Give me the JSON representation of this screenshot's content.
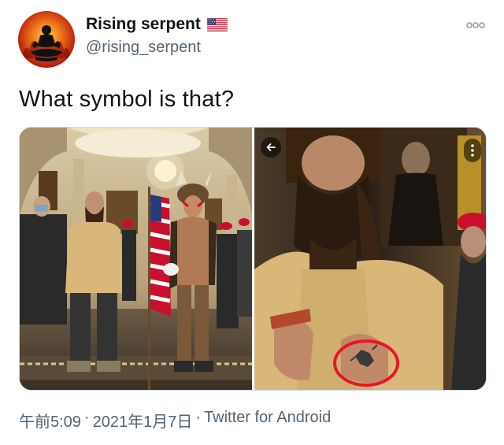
{
  "tweet": {
    "author": {
      "display_name": "Rising serpent",
      "handle": "@rising_serpent",
      "avatar_icon": "meditating-figure-avatar",
      "badge_icon": "us-flag-icon"
    },
    "text": "What symbol is that?",
    "more_icon": "more-options-icon",
    "media": {
      "count": 2,
      "left_photo": "group-of-people-in-capitol-hall",
      "right_photo": "zoomed-man-with-circled-tattoo",
      "back_icon": "back-arrow-icon",
      "menu_icon": "vertical-dots-icon",
      "highlight_color": "#e8152b"
    },
    "meta": {
      "time": "午前5:09",
      "separator1": "·",
      "date": "2021年1月7日",
      "separator2": "·",
      "source": "Twitter for Android"
    }
  },
  "colors": {
    "primary_text": "#0f1419",
    "secondary_text": "#536471",
    "background": "#ffffff"
  }
}
